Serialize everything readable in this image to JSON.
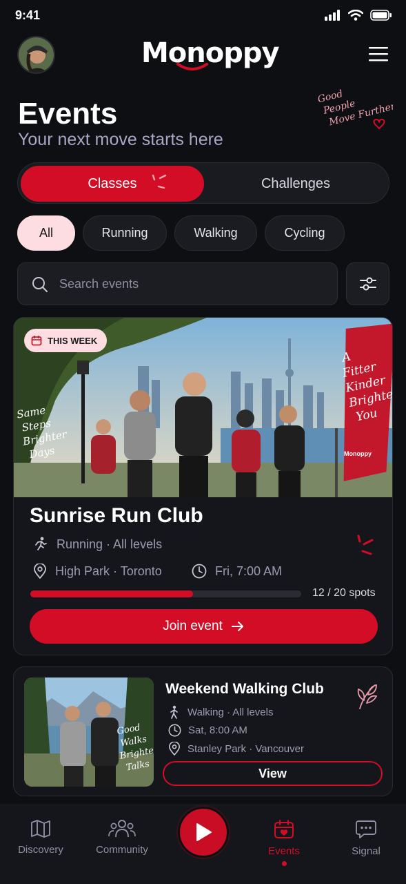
{
  "status_bar": {
    "time": "9:41"
  },
  "header": {
    "brand": "Monoppy"
  },
  "page": {
    "title": "Events",
    "subtitle": "Your next move starts here",
    "tagline": [
      "Good",
      "People",
      "Move Further"
    ]
  },
  "tabs": [
    {
      "label": "Classes",
      "active": true
    },
    {
      "label": "Challenges",
      "active": false
    }
  ],
  "filters": [
    {
      "label": "All",
      "active": true
    },
    {
      "label": "Running",
      "active": false
    },
    {
      "label": "Walking",
      "active": false
    },
    {
      "label": "Cycling",
      "active": false
    }
  ],
  "search": {
    "placeholder": "Search events"
  },
  "featured_event": {
    "badge": "THIS WEEK",
    "title": "Sunrise Run Club",
    "activity": "Running · All levels",
    "location": "High Park · Toronto",
    "time": "Fri, 7:00 AM",
    "spots_taken": 12,
    "spots_total": 20,
    "spots_label": "12 / 20 spots",
    "cta": "Join event",
    "image_text_left": [
      "Same",
      "Steps",
      "Brighter",
      "Days"
    ],
    "image_banner_text": [
      "A",
      "Fitter",
      "Kinder",
      "Brighter",
      "You"
    ],
    "image_banner_brand": "Monoppy"
  },
  "event_card": {
    "title": "Weekend Walking Club",
    "activity": "Walking · All levels",
    "time": "Sat, 8:00 AM",
    "location": "Stanley Park · Vancouver",
    "cta": "View",
    "image_text": [
      "Good",
      "Walks",
      "Brighter",
      "Talks"
    ]
  },
  "bottom_nav": [
    {
      "label": "Discovery",
      "icon": "map-icon",
      "active": false
    },
    {
      "label": "Community",
      "icon": "people-icon",
      "active": false
    },
    {
      "label": "Events",
      "icon": "calendar-icon",
      "active": true
    },
    {
      "label": "Signal",
      "icon": "chat-bubble-icon",
      "active": false
    }
  ],
  "colors": {
    "accent": "#d40d26",
    "chip_active": "#fddde2",
    "background": "#0e0f13"
  }
}
